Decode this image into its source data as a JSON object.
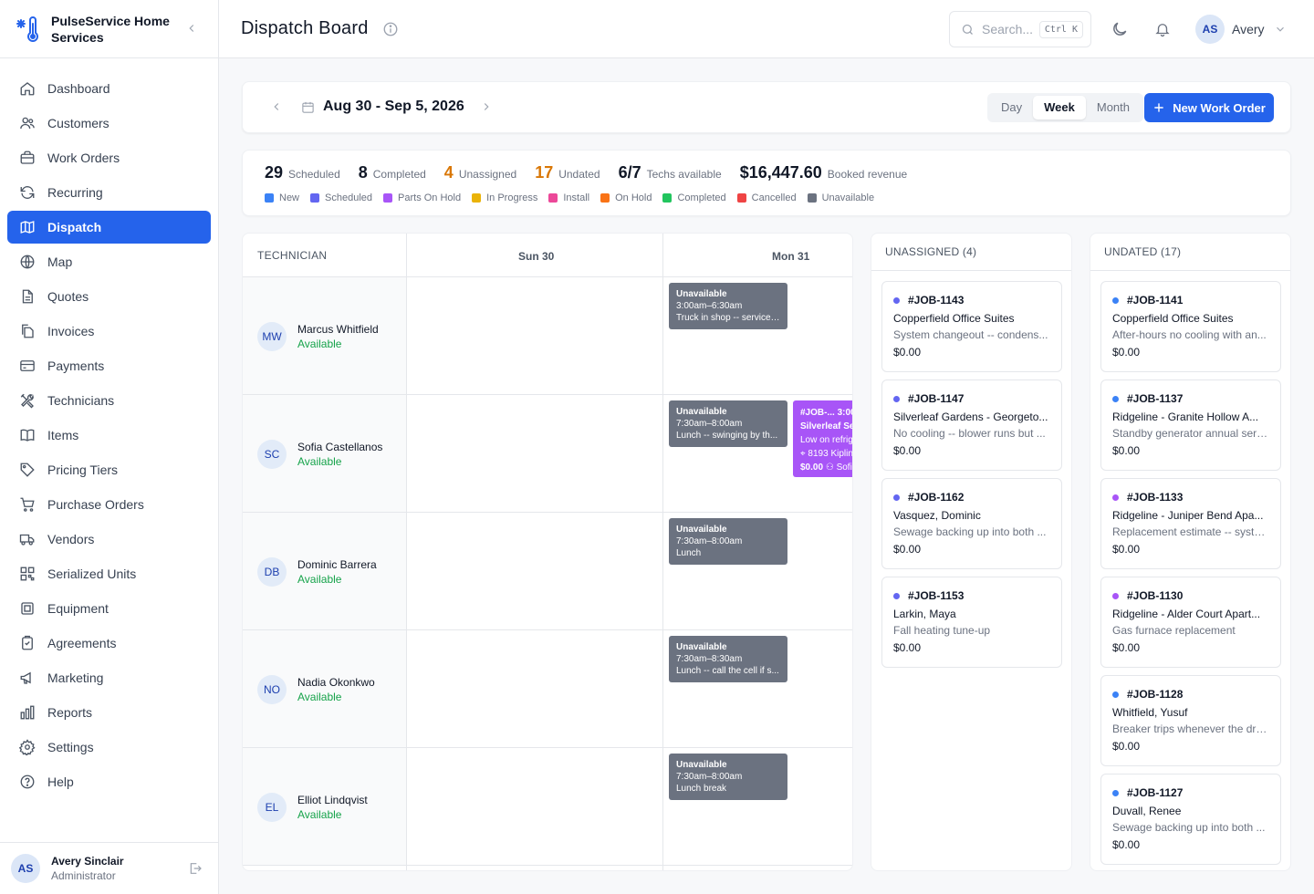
{
  "brand": {
    "name": "PulseService Home Services"
  },
  "nav": [
    {
      "label": "Dashboard",
      "icon": "home-icon"
    },
    {
      "label": "Customers",
      "icon": "users-icon"
    },
    {
      "label": "Work Orders",
      "icon": "briefcase-icon"
    },
    {
      "label": "Recurring",
      "icon": "refresh-icon"
    },
    {
      "label": "Dispatch",
      "icon": "map-book-icon",
      "active": true
    },
    {
      "label": "Map",
      "icon": "globe-icon"
    },
    {
      "label": "Quotes",
      "icon": "document-icon"
    },
    {
      "label": "Invoices",
      "icon": "files-icon"
    },
    {
      "label": "Payments",
      "icon": "credit-card-icon"
    },
    {
      "label": "Technicians",
      "icon": "tools-icon"
    },
    {
      "label": "Items",
      "icon": "book-icon"
    },
    {
      "label": "Pricing Tiers",
      "icon": "tag-icon"
    },
    {
      "label": "Purchase Orders",
      "icon": "cart-icon"
    },
    {
      "label": "Vendors",
      "icon": "truck-icon"
    },
    {
      "label": "Serialized Units",
      "icon": "qr-icon"
    },
    {
      "label": "Equipment",
      "icon": "chip-icon"
    },
    {
      "label": "Agreements",
      "icon": "clipboard-icon"
    },
    {
      "label": "Marketing",
      "icon": "megaphone-icon"
    },
    {
      "label": "Reports",
      "icon": "bar-chart-icon"
    },
    {
      "label": "Settings",
      "icon": "gear-icon"
    },
    {
      "label": "Help",
      "icon": "help-icon"
    }
  ],
  "footer_user": {
    "initials": "AS",
    "name": "Avery Sinclair",
    "role": "Administrator"
  },
  "header": {
    "title": "Dispatch Board",
    "search_placeholder": "Search...",
    "search_shortcut": "Ctrl K",
    "user_initials": "AS",
    "user_name": "Avery"
  },
  "datebar": {
    "range": "Aug 30 - Sep 5, 2026",
    "views": [
      "Day",
      "Week",
      "Month"
    ],
    "active_view": "Week",
    "new_button": "New Work Order"
  },
  "stats": [
    {
      "value": "29",
      "label": "Scheduled"
    },
    {
      "value": "8",
      "label": "Completed"
    },
    {
      "value": "4",
      "label": "Unassigned",
      "warn": true
    },
    {
      "value": "17",
      "label": "Undated",
      "warn": true
    },
    {
      "value": "6/7",
      "label": "Techs available"
    },
    {
      "value": "$16,447.60",
      "label": "Booked revenue"
    }
  ],
  "legend": [
    {
      "label": "New",
      "color": "#3b82f6"
    },
    {
      "label": "Scheduled",
      "color": "#6366f1"
    },
    {
      "label": "Parts On Hold",
      "color": "#a855f7"
    },
    {
      "label": "In Progress",
      "color": "#eab308"
    },
    {
      "label": "Install",
      "color": "#ec4899"
    },
    {
      "label": "On Hold",
      "color": "#f97316"
    },
    {
      "label": "Completed",
      "color": "#22c55e"
    },
    {
      "label": "Cancelled",
      "color": "#ef4444"
    },
    {
      "label": "Unavailable",
      "color": "#6b7280"
    }
  ],
  "board": {
    "tech_header": "TECHNICIAN",
    "days": [
      "Sun 30",
      "Mon 31"
    ],
    "technicians": [
      {
        "initials": "MW",
        "name": "Marcus Whitfield",
        "status": "Available",
        "block": {
          "title": "Unavailable",
          "time": "3:00am–6:30am",
          "note": "Truck in shop -- service ..."
        }
      },
      {
        "initials": "SC",
        "name": "Sofia Castellanos",
        "status": "Available",
        "block": {
          "title": "Unavailable",
          "time": "7:30am–8:00am",
          "note": "Lunch -- swinging by th..."
        }
      },
      {
        "initials": "DB",
        "name": "Dominic Barrera",
        "status": "Available",
        "block": {
          "title": "Unavailable",
          "time": "7:30am–8:00am",
          "note": "Lunch"
        }
      },
      {
        "initials": "NO",
        "name": "Nadia Okonkwo",
        "status": "Available",
        "block": {
          "title": "Unavailable",
          "time": "7:30am–8:30am",
          "note": "Lunch -- call the cell if s..."
        }
      },
      {
        "initials": "EL",
        "name": "Elliot Lindqvist",
        "status": "Available",
        "block": {
          "title": "Unavailable",
          "time": "7:30am–8:00am",
          "note": "Lunch break"
        }
      }
    ],
    "job_chip": {
      "line1": "#JOB-...  3:00",
      "line2": "Silverleaf Ser",
      "line3": "Low on refrig",
      "line4": "8193 Kiplin",
      "amount": "$0.00",
      "tech": "Sofi",
      "color": "#a855f7"
    }
  },
  "unassigned": {
    "title": "UNASSIGNED (4)",
    "cards": [
      {
        "id": "#JOB-1143",
        "customer": "Copperfield Office Suites",
        "desc": "System changeout -- condens...",
        "amount": "$0.00",
        "color": "#6366f1"
      },
      {
        "id": "#JOB-1147",
        "customer": "Silverleaf Gardens - Georgeto...",
        "desc": "No cooling -- blower runs but ...",
        "amount": "$0.00",
        "color": "#6366f1"
      },
      {
        "id": "#JOB-1162",
        "customer": "Vasquez, Dominic",
        "desc": "Sewage backing up into both ...",
        "amount": "$0.00",
        "color": "#6366f1"
      },
      {
        "id": "#JOB-1153",
        "customer": "Larkin, Maya",
        "desc": "Fall heating tune-up",
        "amount": "$0.00",
        "color": "#6366f1"
      }
    ]
  },
  "undated": {
    "title": "UNDATED (17)",
    "cards": [
      {
        "id": "#JOB-1141",
        "customer": "Copperfield Office Suites",
        "desc": "After-hours no cooling with an...",
        "amount": "$0.00",
        "color": "#3b82f6"
      },
      {
        "id": "#JOB-1137",
        "customer": "Ridgeline - Granite Hollow A...",
        "desc": "Standby generator annual serv...",
        "amount": "$0.00",
        "color": "#3b82f6"
      },
      {
        "id": "#JOB-1133",
        "customer": "Ridgeline - Juniper Bend Apa...",
        "desc": "Replacement estimate -- syste...",
        "amount": "$0.00",
        "color": "#a855f7"
      },
      {
        "id": "#JOB-1130",
        "customer": "Ridgeline - Alder Court Apart...",
        "desc": "Gas furnace replacement",
        "amount": "$0.00",
        "color": "#a855f7"
      },
      {
        "id": "#JOB-1128",
        "customer": "Whitfield, Yusuf",
        "desc": "Breaker trips whenever the dry...",
        "amount": "$0.00",
        "color": "#3b82f6"
      },
      {
        "id": "#JOB-1127",
        "customer": "Duvall, Renee",
        "desc": "Sewage backing up into both ...",
        "amount": "$0.00",
        "color": "#3b82f6"
      }
    ]
  }
}
